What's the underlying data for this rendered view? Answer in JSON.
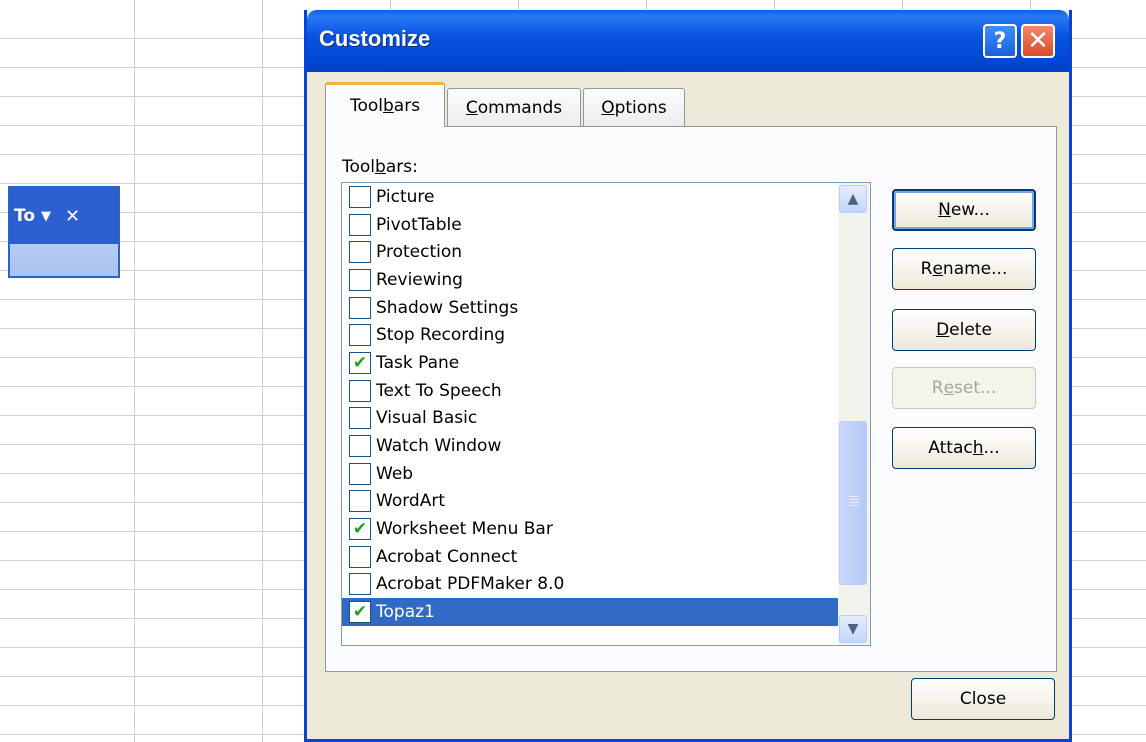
{
  "dialog": {
    "title": "Customize",
    "help_glyph": "?",
    "close_glyph": "✕"
  },
  "mini_toolbar": {
    "title": "To",
    "dropdown_glyph": "▼",
    "close_glyph": "✕"
  },
  "tabs": [
    {
      "pre": "Tool",
      "key": "b",
      "post": "ars"
    },
    {
      "pre": "",
      "key": "C",
      "post": "ommands"
    },
    {
      "pre": "",
      "key": "O",
      "post": "ptions"
    }
  ],
  "toolbars_label": {
    "pre": "Tool",
    "key": "b",
    "post": "ars:"
  },
  "toolbars_list": [
    {
      "label": "Picture",
      "checked": false
    },
    {
      "label": "PivotTable",
      "checked": false
    },
    {
      "label": "Protection",
      "checked": false
    },
    {
      "label": "Reviewing",
      "checked": false
    },
    {
      "label": "Shadow Settings",
      "checked": false
    },
    {
      "label": "Stop Recording",
      "checked": false
    },
    {
      "label": "Task Pane",
      "checked": true
    },
    {
      "label": "Text To Speech",
      "checked": false
    },
    {
      "label": "Visual Basic",
      "checked": false
    },
    {
      "label": "Watch Window",
      "checked": false
    },
    {
      "label": "Web",
      "checked": false
    },
    {
      "label": "WordArt",
      "checked": false
    },
    {
      "label": "Worksheet Menu Bar",
      "checked": true
    },
    {
      "label": "Acrobat Connect",
      "checked": false
    },
    {
      "label": "Acrobat PDFMaker 8.0",
      "checked": false
    },
    {
      "label": "Topaz1",
      "checked": true,
      "selected": true
    }
  ],
  "buttons": {
    "new": {
      "pre": "",
      "key": "N",
      "post": "ew..."
    },
    "rename": {
      "pre": "R",
      "key": "e",
      "post": "name..."
    },
    "delete": {
      "pre": "",
      "key": "D",
      "post": "elete"
    },
    "reset": {
      "pre": "R",
      "key": "e",
      "post": "set..."
    },
    "attach": {
      "pre": "Attac",
      "key": "h",
      "post": "..."
    },
    "close": "Close"
  },
  "colors": {
    "titlebar": "#0046d5",
    "selection": "#316ac5",
    "check": "#21a121"
  }
}
